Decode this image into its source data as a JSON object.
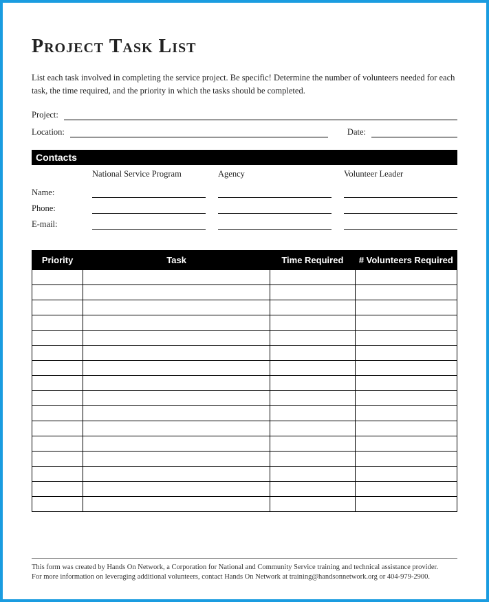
{
  "title": "Project Task List",
  "instructions": "List each task involved in completing the service project. Be specific! Determine the number of volunteers needed for each task, the time required, and the priority in which the tasks should be completed.",
  "fields": {
    "project_label": "Project:",
    "location_label": "Location:",
    "date_label": "Date:"
  },
  "contacts": {
    "section_title": "Contacts",
    "col1": "National Service Program",
    "col2": "Agency",
    "col3": "Volunteer Leader",
    "row_name": "Name:",
    "row_phone": "Phone:",
    "row_email": "E-mail:"
  },
  "table": {
    "headers": {
      "priority": "Priority",
      "task": "Task",
      "time": "Time Required",
      "volunteers": "# Volunteers Required"
    },
    "row_count": 16
  },
  "footer": {
    "line1": "This form was created by Hands On Network, a Corporation for National and Community Service training and technical assistance provider.",
    "line2": "For more information on leveraging additional volunteers, contact Hands On Network at training@handsonnetwork.org or 404-979-2900."
  }
}
